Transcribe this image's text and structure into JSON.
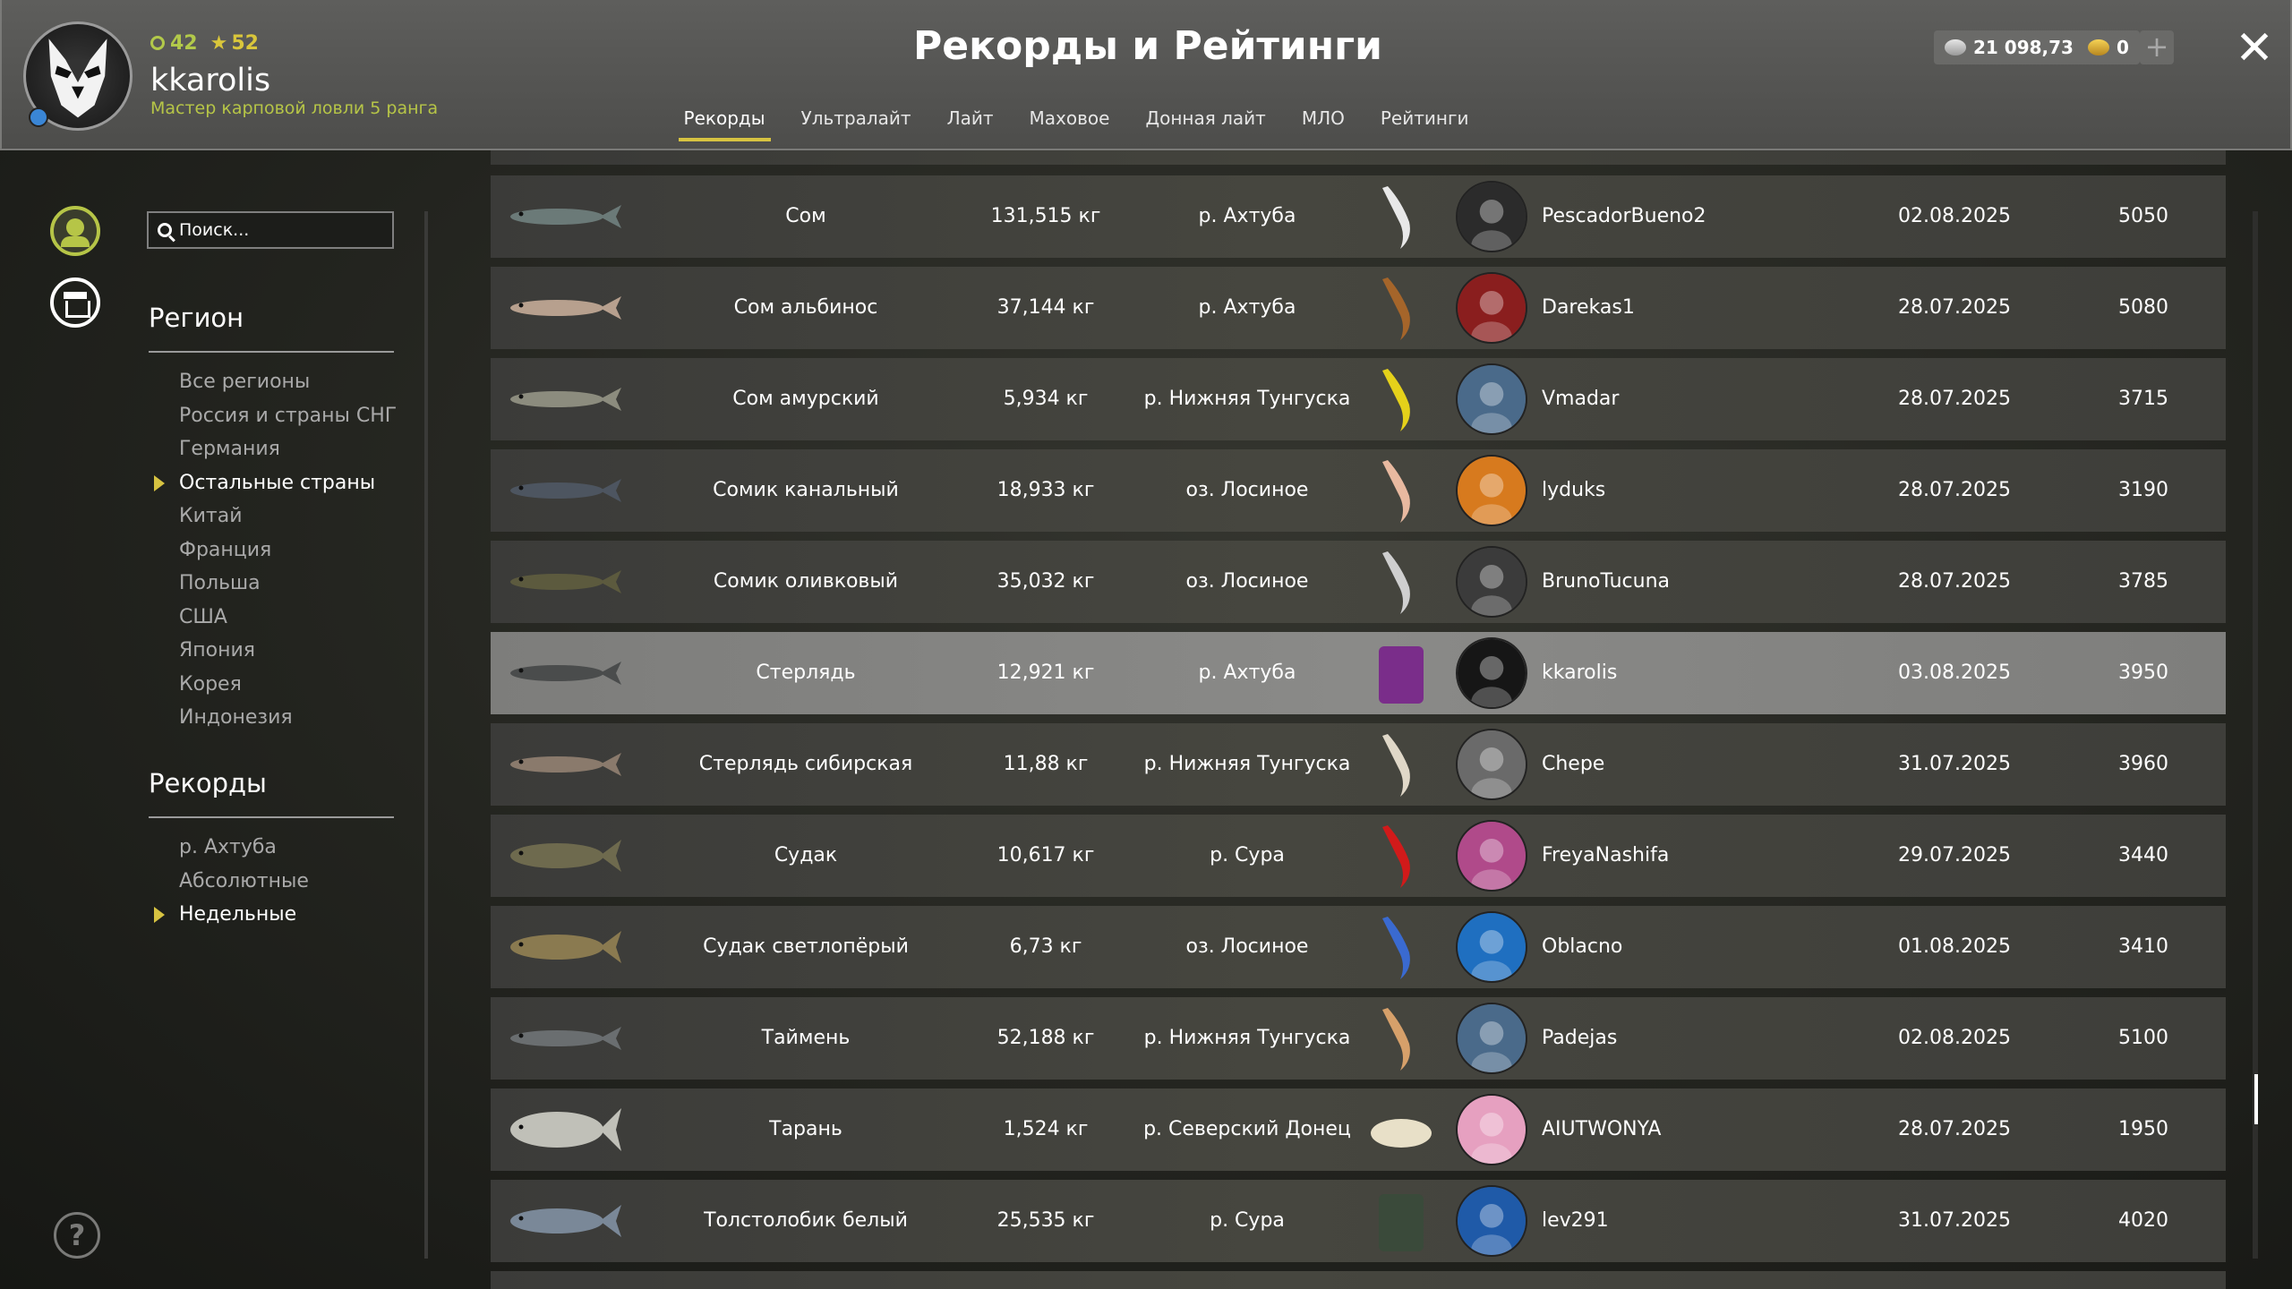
{
  "profile": {
    "level": "42",
    "stars": "52",
    "username": "kkarolis",
    "rank_title": "Мастер карповой ловли 5 ранга"
  },
  "header": {
    "title": "Рекорды и Рейтинги",
    "tabs": [
      {
        "label": "Рекорды",
        "active": true
      },
      {
        "label": "Ультралайт"
      },
      {
        "label": "Лайт"
      },
      {
        "label": "Маховое"
      },
      {
        "label": "Донная лайт"
      },
      {
        "label": "МЛО"
      },
      {
        "label": "Рейтинги"
      }
    ],
    "silver": "21 098,73",
    "gold": "0",
    "plus": "+",
    "close": "✕"
  },
  "sidebar": {
    "search_placeholder": "Поиск...",
    "region_heading": "Регион",
    "regions": [
      "Все регионы",
      "Россия и страны СНГ",
      "Германия",
      "Остальные страны",
      "Китай",
      "Франция",
      "Польша",
      "США",
      "Япония",
      "Корея",
      "Индонезия"
    ],
    "active_region": "Остальные страны",
    "records_heading": "Рекорды",
    "records": [
      "р. Ахтуба",
      "Абсолютные",
      "Недельные"
    ],
    "active_record": "Недельные",
    "help": "?"
  },
  "rows": [
    {
      "fish": "Сом",
      "weight": "131,515 кг",
      "location": "р. Ахтуба",
      "bait": "white-softbait-icon",
      "player": "PescadorBueno2",
      "date": "02.08.2025",
      "points": "5050"
    },
    {
      "fish": "Сом альбинос",
      "weight": "37,144 кг",
      "location": "р. Ахтуба",
      "bait": "shrimp-icon",
      "player": "Darekas1",
      "date": "28.07.2025",
      "points": "5080"
    },
    {
      "fish": "Сом амурский",
      "weight": "5,934 кг",
      "location": "р. Нижняя Тунгуска",
      "bait": "yellow-softbait-icon",
      "player": "Vmadar",
      "date": "28.07.2025",
      "points": "3715"
    },
    {
      "fish": "Сомик канальный",
      "weight": "18,933 кг",
      "location": "оз. Лосиное",
      "bait": "meat-cut-icon",
      "player": "lyduks",
      "date": "28.07.2025",
      "points": "3190"
    },
    {
      "fish": "Сомик оливковый",
      "weight": "35,032 кг",
      "location": "оз. Лосиное",
      "bait": "grub-icon",
      "player": "BrunoTucuna",
      "date": "28.07.2025",
      "points": "3785"
    },
    {
      "fish": "Стерлядь",
      "weight": "12,921 кг",
      "location": "р. Ахтуба",
      "bait": "bait-tub-icon",
      "player": "kkarolis",
      "date": "03.08.2025",
      "points": "3950",
      "highlight": true
    },
    {
      "fish": "Стерлядь сибирская",
      "weight": "11,88 кг",
      "location": "р. Нижняя Тунгуска",
      "bait": "larva-icon",
      "player": "Chepe",
      "date": "31.07.2025",
      "points": "3960"
    },
    {
      "fish": "Судак",
      "weight": "10,617 кг",
      "location": "р. Сура",
      "bait": "red-twister-icon",
      "player": "FreyaNashifa",
      "date": "29.07.2025",
      "points": "3440"
    },
    {
      "fish": "Судак светлопёрый",
      "weight": "6,73 кг",
      "location": "оз. Лосиное",
      "bait": "crayfish-icon",
      "player": "Oblacno",
      "date": "01.08.2025",
      "points": "3410"
    },
    {
      "fish": "Таймень",
      "weight": "52,188 кг",
      "location": "р. Нижняя Тунгуска",
      "bait": "shrimp-icon",
      "player": "Padejas",
      "date": "02.08.2025",
      "points": "5100"
    },
    {
      "fish": "Тарань",
      "weight": "1,524 кг",
      "location": "р. Северский Донец",
      "bait": "grain-pellets-icon",
      "player": "AIUTWONYA",
      "date": "28.07.2025",
      "points": "1950"
    },
    {
      "fish": "Толстолобик белый",
      "weight": "25,535 кг",
      "location": "р. Сура",
      "bait": "boilie-jar-icon",
      "player": "lev291",
      "date": "31.07.2025",
      "points": "4020"
    }
  ],
  "colors": {
    "accent": "#d7c341",
    "rank": "#b6c547",
    "row": "#42423d",
    "row_highlight": "#858583"
  }
}
